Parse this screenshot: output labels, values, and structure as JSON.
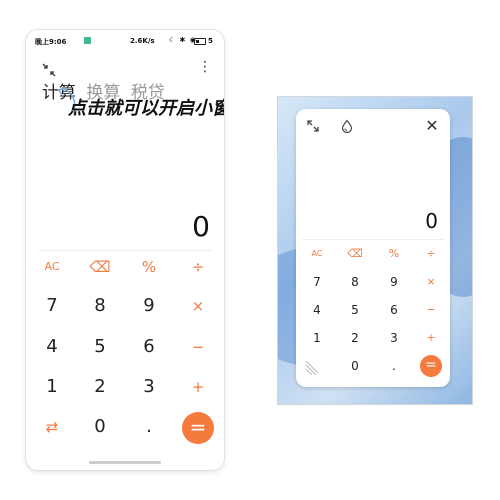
{
  "status_bar": {
    "time": "晚上9:06",
    "network_speed": "2.6K/s",
    "status_icons": "☾ ✱ ◉",
    "battery_label": "5"
  },
  "accent_color": "#f57a3e",
  "tabs": [
    {
      "label": "计算",
      "active": true
    },
    {
      "label": "换算",
      "active": false
    },
    {
      "label": "税贷",
      "active": false
    }
  ],
  "annotation_text": "点击就可以开启小窗",
  "display": {
    "value": "0"
  },
  "keypad": {
    "row1": [
      "AC",
      "⌫",
      "%",
      "÷"
    ],
    "row2": [
      "7",
      "8",
      "9",
      "×"
    ],
    "row3": [
      "4",
      "5",
      "6",
      "−"
    ],
    "row4": [
      "1",
      "2",
      "3",
      "+"
    ],
    "row5": [
      "⇄",
      "0",
      ".",
      "="
    ]
  },
  "floating_window": {
    "close_label": "✕",
    "display_value": "0",
    "keypad": {
      "row1": [
        "AC",
        "⌫",
        "%",
        "÷"
      ],
      "row2": [
        "7",
        "8",
        "9",
        "×"
      ],
      "row3": [
        "4",
        "5",
        "6",
        "−"
      ],
      "row4": [
        "1",
        "2",
        "3",
        "+"
      ],
      "row5": [
        "0",
        ".",
        "="
      ]
    }
  },
  "icons": {
    "shrink": "shrink-window-icon",
    "more": "more-vertical-icon",
    "expand": "expand-icon",
    "theme": "drop-icon",
    "resize": "resize-handle-icon"
  }
}
